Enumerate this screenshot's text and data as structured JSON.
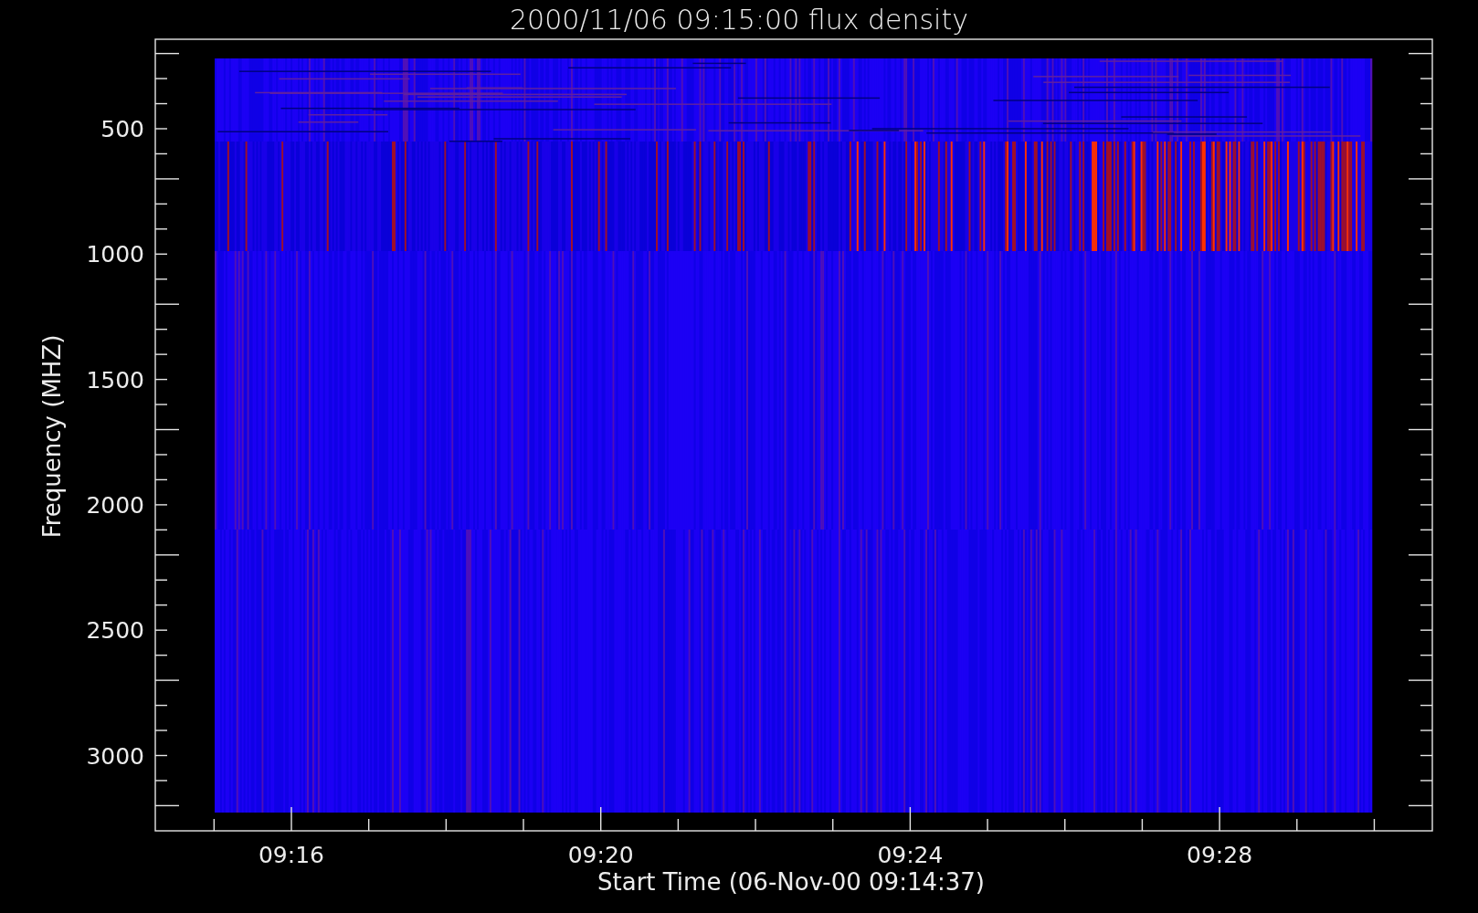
{
  "title": "2000/11/06 09:15:00 flux density",
  "plot": {
    "x_axis": {
      "label": "Start Time (06-Nov-00 09:14:37)",
      "ticks": [
        "09:16",
        "09:20",
        "09:24",
        "09:28"
      ]
    },
    "y_axis": {
      "label": "Frequency (MHZ)",
      "ticks": [
        "500",
        "1000",
        "1500",
        "2000",
        "2500",
        "3000"
      ]
    }
  }
}
